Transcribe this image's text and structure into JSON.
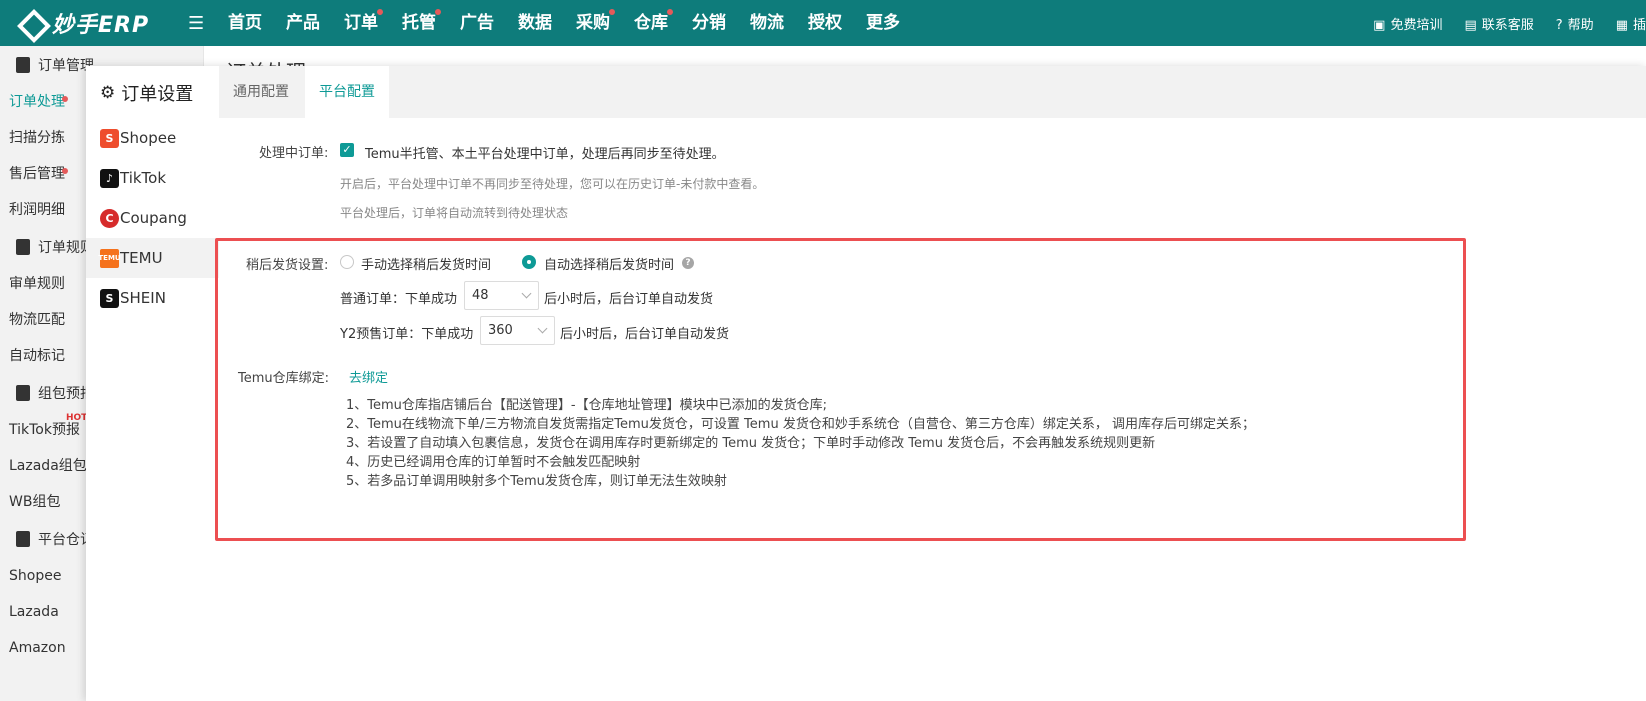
{
  "app": {
    "logo_text": "妙手ERP"
  },
  "topnav": {
    "items": [
      {
        "label": "首页",
        "dot": false
      },
      {
        "label": "产品",
        "dot": false
      },
      {
        "label": "订单",
        "dot": true
      },
      {
        "label": "托管",
        "dot": true
      },
      {
        "label": "广告",
        "dot": false
      },
      {
        "label": "数据",
        "dot": false
      },
      {
        "label": "采购",
        "dot": true
      },
      {
        "label": "仓库",
        "dot": true
      },
      {
        "label": "分销",
        "dot": false
      },
      {
        "label": "物流",
        "dot": false
      },
      {
        "label": "授权",
        "dot": false
      },
      {
        "label": "更多",
        "dot": false
      }
    ],
    "right": {
      "training": "免费培训",
      "support": "联系客服",
      "help": "帮助",
      "plugin": "插"
    }
  },
  "bg": {
    "page_title": "订单处理",
    "sidebar": {
      "group1": "订单管理",
      "items1": [
        "订单处理",
        "扫描分拣",
        "售后管理",
        "利润明细"
      ],
      "group2": "订单规则",
      "items2": [
        "审单规则",
        "物流匹配",
        "自动标记"
      ],
      "group3": "组包预报",
      "items3": [
        "TikTok预报",
        "Lazada组包",
        "WB组包"
      ],
      "hot_badge": "HOT",
      "group4": "平台仓订单",
      "items4": [
        "Shopee",
        "Lazada",
        "Amazon"
      ]
    }
  },
  "modal": {
    "title": "订单设置",
    "tabs": [
      "通用配置",
      "平台配置"
    ],
    "active_tab": 1,
    "platforms": [
      {
        "label": "Shopee",
        "icon": "shopee-icon",
        "glyph": "S"
      },
      {
        "label": "TikTok",
        "icon": "tiktok-icon",
        "glyph": "♪"
      },
      {
        "label": "Coupang",
        "icon": "coupang-icon",
        "glyph": "C"
      },
      {
        "label": "TEMU",
        "icon": "temu-icon",
        "glyph": "TEMU"
      },
      {
        "label": "SHEIN",
        "icon": "shein-icon",
        "glyph": "S"
      }
    ],
    "active_platform": 3,
    "processing": {
      "label": "处理中订单:",
      "checkbox_text": "Temu半托管、本土平台处理中订单，处理后再同步至待处理。",
      "checked": true,
      "hint1": "开启后，平台处理中订单不再同步至待处理，您可以在历史订单-未付款中查看。",
      "hint2": "平台处理后，订单将自动流转到待处理状态"
    },
    "delayed": {
      "label": "稍后发货设置:",
      "option_manual": "手动选择稍后发货时间",
      "option_auto": "自动选择稍后发货时间",
      "selected": "auto",
      "normal_prefix": "普通订单：下单成功",
      "normal_value": "48",
      "normal_suffix": "后小时后，后台订单自动发货",
      "presale_prefix": "Y2预售订单：下单成功",
      "presale_value": "360",
      "presale_suffix": "后小时后，后台订单自动发货"
    },
    "warehouse": {
      "label": "Temu仓库绑定:",
      "bind_link": "去绑定",
      "notes": [
        "1、Temu仓库指店铺后台【配送管理】-【仓库地址管理】模块中已添加的发货仓库;",
        "2、Temu在线物流下单/三方物流自发货需指定Temu发货仓，可设置 Temu 发货仓和妙手系统仓（自营仓、第三方仓库）绑定关系， 调用库存后可绑定关系；",
        "3、若设置了自动填入包裹信息，发货仓在调用库存时更新绑定的 Temu 发货仓；下单时手动修改 Temu 发货仓后，不会再触发系统规则更新",
        "4、历史已经调用仓库的订单暂时不会触发匹配映射",
        "5、若多品订单调用映射多个Temu发货仓库，则订单无法生效映射"
      ]
    },
    "highlight_color": "#ec4f51",
    "accent_color": "#0e9a96"
  }
}
